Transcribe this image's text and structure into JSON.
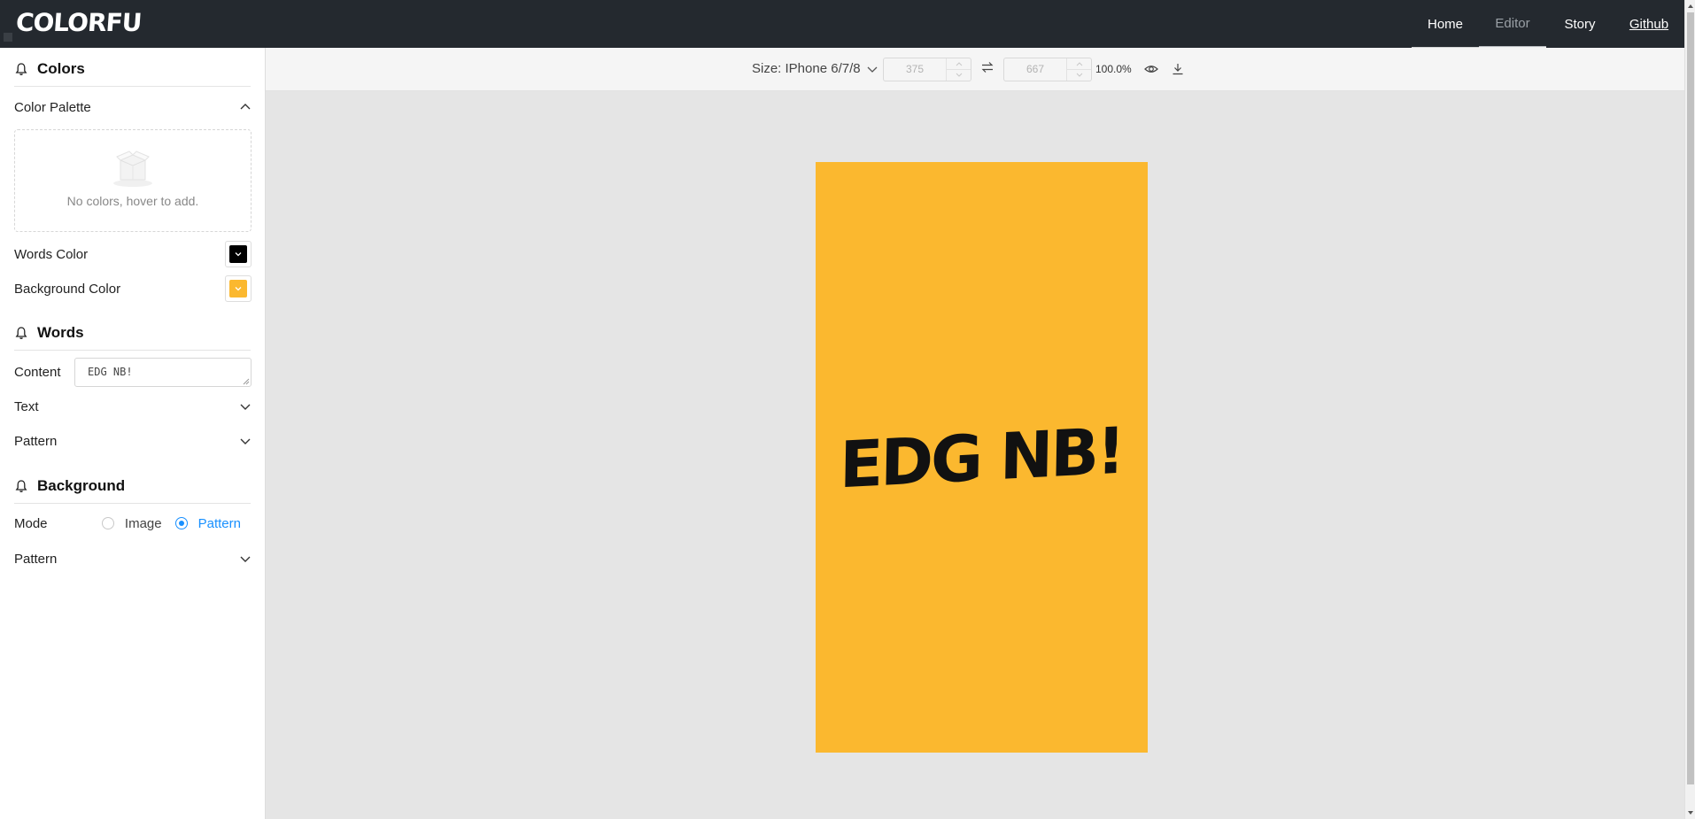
{
  "header": {
    "logo": "COLORFU",
    "nav": [
      {
        "label": "Home"
      },
      {
        "label": "Editor"
      },
      {
        "label": "Story"
      },
      {
        "label": "Github"
      }
    ]
  },
  "sidebar": {
    "colors": {
      "title": "Colors",
      "palette_label": "Color Palette",
      "palette_empty": "No colors, hover to add.",
      "words_color_label": "Words Color",
      "words_color": "#000000",
      "background_color_label": "Background Color",
      "background_color": "#fbb82f"
    },
    "words": {
      "title": "Words",
      "content_label": "Content",
      "content_value": "EDG NB!",
      "text_label": "Text",
      "pattern_label": "Pattern"
    },
    "background": {
      "title": "Background",
      "mode_label": "Mode",
      "mode_options": [
        "Image",
        "Pattern"
      ],
      "mode_selected": "Pattern",
      "pattern_label": "Pattern"
    }
  },
  "toolbar": {
    "size_label": "Size: IPhone 6/7/8",
    "width": "375",
    "height": "667",
    "zoom": "100.0%"
  },
  "preview": {
    "text": "EDG NB!",
    "background": "#fbb82f",
    "text_color": "#000000"
  }
}
